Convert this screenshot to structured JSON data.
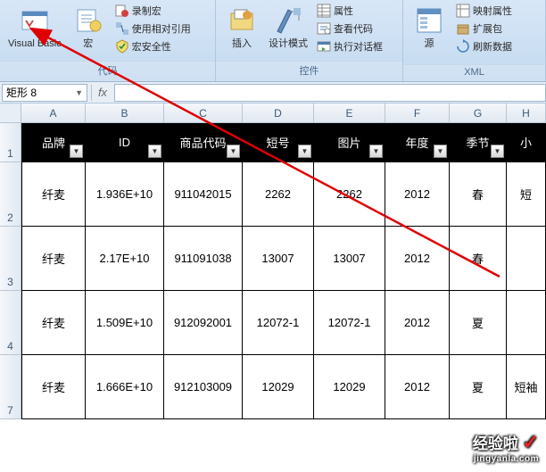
{
  "ribbon": {
    "group_code": {
      "label": "代码",
      "vb": "Visual Basic",
      "macro": "宏",
      "rec": "录制宏",
      "rel": "使用相对引用",
      "sec": "宏安全性"
    },
    "group_ctrl": {
      "label": "控件",
      "insert": "插入",
      "design": "设计模式",
      "prop": "属性",
      "viewcode": "查看代码",
      "rundlg": "执行对话框"
    },
    "group_xml": {
      "label": "XML",
      "source": "源",
      "mapprop": "映射属性",
      "expand": "扩展包",
      "refresh": "刷新数据"
    }
  },
  "namebox": "矩形 8",
  "fx": "fx",
  "cols": [
    "A",
    "B",
    "C",
    "D",
    "E",
    "F",
    "G",
    "H"
  ],
  "rows": [
    "1",
    "2",
    "3",
    "4",
    "7"
  ],
  "header": [
    "品牌",
    "ID",
    "商品代码",
    "短号",
    "图片",
    "年度",
    "季节",
    "小"
  ],
  "data": [
    [
      "纤麦",
      "1.936E+10",
      "911042015",
      "2262",
      "2262",
      "2012",
      "春",
      "短"
    ],
    [
      "纤麦",
      "2.17E+10",
      "911091038",
      "13007",
      "13007",
      "2012",
      "春",
      ""
    ],
    [
      "纤麦",
      "1.509E+10",
      "912092001",
      "12072-1",
      "12072-1",
      "2012",
      "夏",
      ""
    ],
    [
      "纤麦",
      "1.666E+10",
      "912103009",
      "12029",
      "12029",
      "2012",
      "夏",
      "短袖"
    ]
  ],
  "watermark": {
    "main": "经验啦",
    "sub": "jingyanla.com",
    "check": "✓"
  },
  "chart_data": {
    "type": "table",
    "title": "",
    "columns": [
      "品牌",
      "ID",
      "商品代码",
      "短号",
      "图片",
      "年度",
      "季节"
    ],
    "rows": [
      [
        "纤麦",
        "1.936E+10",
        "911042015",
        "2262",
        "2262",
        "2012",
        "春"
      ],
      [
        "纤麦",
        "2.17E+10",
        "911091038",
        "13007",
        "13007",
        "2012",
        "春"
      ],
      [
        "纤麦",
        "1.509E+10",
        "912092001",
        "12072-1",
        "12072-1",
        "2012",
        "夏"
      ],
      [
        "纤麦",
        "1.666E+10",
        "912103009",
        "12029",
        "12029",
        "2012",
        "夏"
      ]
    ]
  }
}
